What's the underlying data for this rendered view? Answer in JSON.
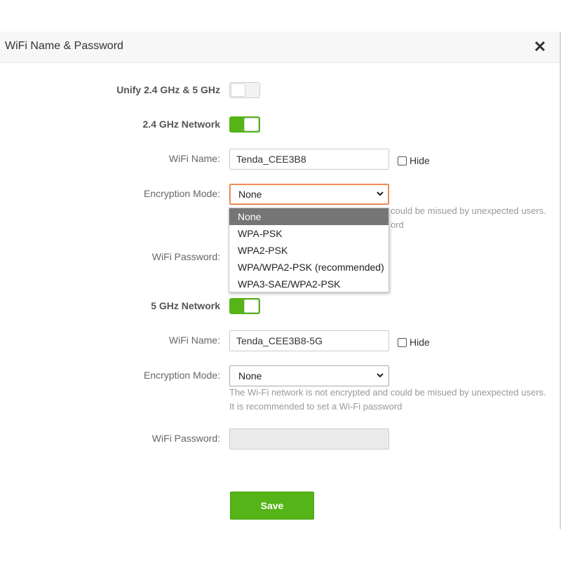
{
  "dialog": {
    "title": "WiFi Name & Password",
    "close_label": "✕"
  },
  "unify": {
    "label": "Unify 2.4 GHz & 5 GHz",
    "enabled": false
  },
  "band_24": {
    "label": "2.4 GHz Network",
    "enabled": true,
    "wifi_name_label": "WiFi Name:",
    "wifi_name_value": "Tenda_CEE3B8",
    "hide_label": "Hide",
    "encryption_label": "Encryption Mode:",
    "encryption_value": "None",
    "hint_line1_partial": "could be misued by unexpected users.",
    "hint_line2_partial": "ord",
    "password_label": "WiFi Password:",
    "dropdown_options": [
      "None",
      "WPA-PSK",
      "WPA2-PSK",
      "WPA/WPA2-PSK (recommended)",
      "WPA3-SAE/WPA2-PSK"
    ]
  },
  "band_5": {
    "label": "5 GHz Network",
    "enabled": true,
    "wifi_name_label": "WiFi Name:",
    "wifi_name_value": "Tenda_CEE3B8-5G",
    "hide_label": "Hide",
    "encryption_label": "Encryption Mode:",
    "encryption_value": "None",
    "hint_line1": "The Wi-Fi network is not encrypted and could be misued by unexpected users.",
    "hint_line2": "It is recommended to set a Wi-Fi password",
    "password_label": "WiFi Password:",
    "password_value": ""
  },
  "actions": {
    "save_label": "Save"
  },
  "colors": {
    "accent_green": "#55b418",
    "focus_orange": "#e8763a",
    "selected_option": "#757575"
  }
}
